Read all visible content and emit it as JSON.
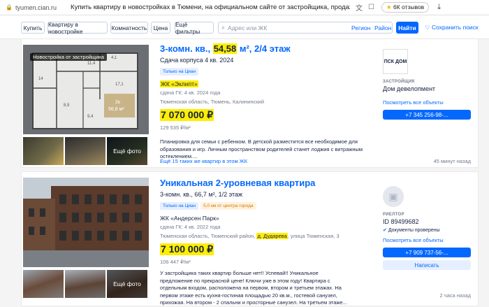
{
  "browser": {
    "domain": "tyumen.cian.ru",
    "page_title": "Купить квартиру в новостройках в Тюмени, на официальном сайте от застройщика, продажа к...",
    "reviews": "6К отзывов"
  },
  "filters": {
    "buy": "Купить",
    "newbuild": "Квартиру в новостройке",
    "rooms": "Комнатность",
    "price": "Цена",
    "more": "Ещё фильтры",
    "search_placeholder": "Адрес или ЖК",
    "region": "Регион",
    "rayon": "Район",
    "find": "Найти",
    "save_search": "Сохранить поиск"
  },
  "listings": [
    {
      "badge": "Новостройка от застройщика",
      "title_prefix": "3-комн. кв., ",
      "title_area": "54,58",
      "title_suffix": " м², 2/4 этаж",
      "completion": "Сдача корпуса 4 кв. 2024",
      "tag": "Только на Циан",
      "complex": "ЖК «Эклипт»",
      "meta": "сдача ГК: 4 кв. 2024 года",
      "address": "Тюменская область, Тюмень, Калининский",
      "price": "7 070 000 ₽",
      "price_per_m": "129 535 ₽/м²",
      "more_photos": "Ещё фото",
      "description": "Планировка для семьи с ребенком. В детской разместится все необходимое для образования и игр. Личным пространством родителей станет лоджия с витражным остеклением....",
      "similar_link": "Ещё 15 таких же квартир в этом ЖК",
      "time": "45 минут назад",
      "seller_logo": "ПСК ДОМ",
      "seller_label": "ЗАСТРОЙЩИК",
      "seller_name": "Дом девелопмент",
      "seller_link": "Посмотреть все объекты",
      "phone": "+7 345 256-98-..."
    },
    {
      "title": "Уникальная 2-уровневая квартира",
      "subtitle": "3-комн. кв., 66,7 м², 1/2 этаж",
      "tag": "Только на Циан",
      "tag2": "5,0 км от центра города",
      "complex": "ЖК «Андерсен Парк»",
      "meta": "сдача ГК: 4 кв. 2022 года",
      "address_pre": "Тюменская область, Тюменский район, ",
      "address_hl": "д. Дударева",
      "address_post": ", улица Тюменская, 3",
      "price": "7 100 000 ₽",
      "price_per_m": "106 447 ₽/м²",
      "more_photos": "Ещё фото",
      "description": "У застройщика таких квартир больше нет!! Успевай!! Уникальное предложение по прекрасной цене! Ключи уже в этом году! Квартира с отдельным входом, расположена на первом, втором и третьем этажах. На первом этаже есть кухня-гостиная площадью 20 кв.м., гостевой санузел, прихожая. На втором - 2 спальни и просторные санузел. На третьем этаже...",
      "time": "2 часа назад",
      "seller_label": "РИЕЛТОР",
      "seller_name": "ID 89499682",
      "verified": "Документы проверены",
      "seller_link": "Посмотреть все объекты",
      "phone": "+7 909 737-56-...",
      "write": "Написать"
    }
  ],
  "plan": {
    "rooms": [
      "4,1",
      "14",
      "11,4",
      "8,9",
      "9,4",
      "17,1"
    ],
    "area_label": "2к",
    "area_value": "56,8 м²"
  },
  "colors": {
    "accent": "#0468ff",
    "highlight": "#ffee00",
    "text": "#152242",
    "muted": "#737a8e"
  }
}
